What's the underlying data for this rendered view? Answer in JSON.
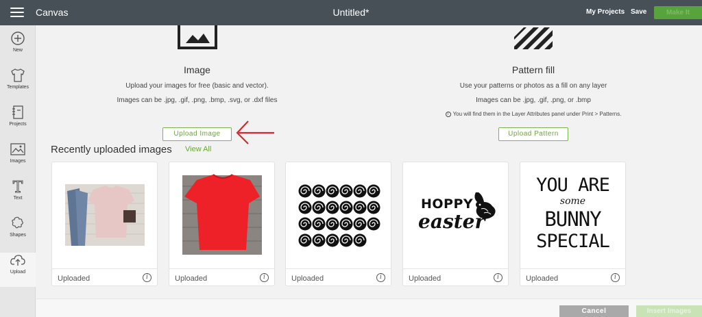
{
  "header": {
    "app_title": "Canvas",
    "doc_title": "Untitled*",
    "my_projects": "My Projects",
    "save": "Save",
    "make_it": "Make It"
  },
  "sidebar": {
    "items": [
      {
        "label": "New",
        "icon": "plus-circle-icon"
      },
      {
        "label": "Templates",
        "icon": "tshirt-icon"
      },
      {
        "label": "Projects",
        "icon": "notebook-icon"
      },
      {
        "label": "Images",
        "icon": "image-icon"
      },
      {
        "label": "Text",
        "icon": "text-t-icon"
      },
      {
        "label": "Shapes",
        "icon": "shapes-icon"
      },
      {
        "label": "Upload",
        "icon": "cloud-upload-icon"
      }
    ],
    "active": "Upload"
  },
  "upload_image": {
    "title": "Image",
    "line1": "Upload your images for free (basic and vector).",
    "line2": "Images can be .jpg, .gif, .png, .bmp, .svg, or .dxf files",
    "button": "Upload Image"
  },
  "pattern_fill": {
    "title": "Pattern fill",
    "line1": "Use your patterns or photos as a fill on any layer",
    "line2": "Images can be .jpg, .gif, .png, or .bmp",
    "note": "You will find them in the Layer Attributes panel under Print > Patterns.",
    "button": "Upload Pattern"
  },
  "recent": {
    "title": "Recently uploaded images",
    "view_all": "View All",
    "cards": [
      {
        "label": "Uploaded",
        "image": "tshirt-jeans-flatlay"
      },
      {
        "label": "Uploaded",
        "image": "red-tshirt"
      },
      {
        "label": "Uploaded",
        "image": "rolled-flowers-pattern"
      },
      {
        "label": "Uploaded",
        "image": "hoppy-easter-design",
        "text_line1": "HOPPY",
        "text_line2": "easter"
      },
      {
        "label": "Uploaded",
        "image": "some-bunny-special-design",
        "text_line1": "YOU ARE",
        "text_line2": "some",
        "text_line3": "BUNNY",
        "text_line4": "SPECIAL"
      }
    ]
  },
  "footer": {
    "cancel": "Cancel",
    "insert": "Insert Images"
  },
  "colors": {
    "topbar": "#475057",
    "accent_green": "#6aa63a",
    "annotation_arrow": "#d9262c"
  }
}
